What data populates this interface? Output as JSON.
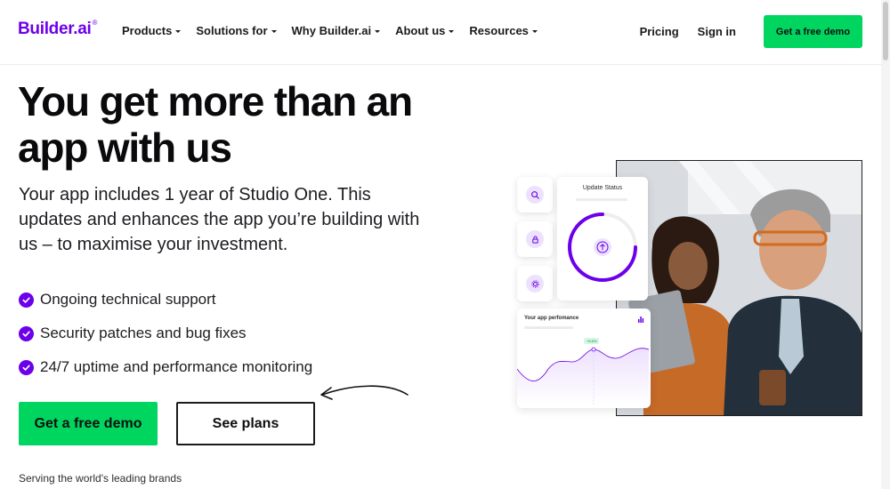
{
  "header": {
    "logo_text": "Builder.ai",
    "logo_mark": "®",
    "nav": [
      {
        "label": "Products",
        "icon": "chevron-down-icon"
      },
      {
        "label": "Solutions for",
        "icon": "chevron-down-icon"
      },
      {
        "label": "Why Builder.ai",
        "icon": "chevron-down-icon"
      },
      {
        "label": "About us",
        "icon": "chevron-down-icon"
      },
      {
        "label": "Resources",
        "icon": "chevron-down-icon"
      }
    ],
    "pricing_label": "Pricing",
    "signin_label": "Sign in",
    "cta_label": "Get a free demo"
  },
  "hero": {
    "title": "You get more than an app with us",
    "subtitle": "Your app includes 1 year of Studio One. This updates and enhances the app you’re building with us – to maximise your investment.",
    "features": [
      "Ongoing technical support",
      "Security patches and bug fixes",
      "24/7 uptime and performance monitoring"
    ],
    "primary_cta": "Get a free demo",
    "secondary_cta": "See plans",
    "brands_text": "Serving the world's leading brands"
  },
  "illustration": {
    "status_card_title": "Update Status",
    "performance_card_title": "Your app perfomance",
    "performance_badge": "+5.6%"
  },
  "colors": {
    "brand_purple": "#6c00ea",
    "cta_green": "#00d65f"
  }
}
